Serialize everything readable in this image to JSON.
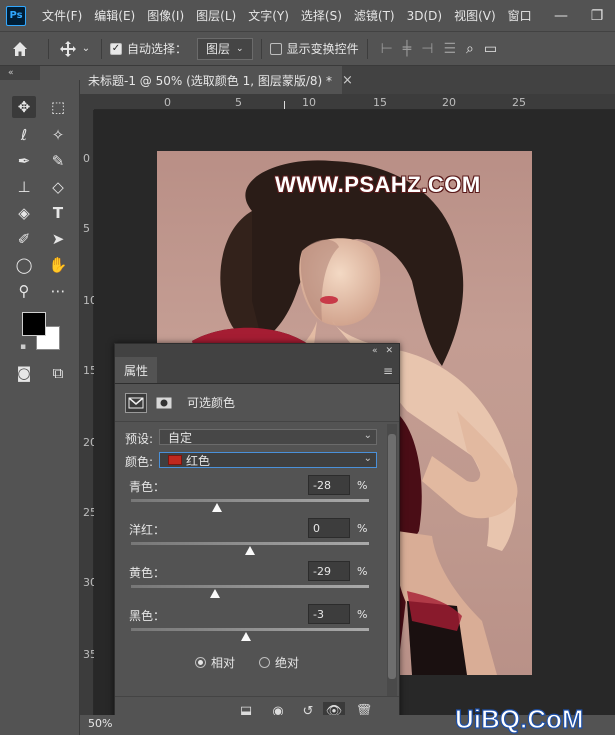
{
  "app": {
    "logo": "Ps"
  },
  "menu": [
    "文件(F)",
    "编辑(E)",
    "图像(I)",
    "图层(L)",
    "文字(Y)",
    "选择(S)",
    "滤镜(T)",
    "3D(D)",
    "视图(V)",
    "窗口"
  ],
  "window_buttons": {
    "minimize": "—",
    "restore": "❐"
  },
  "options_bar": {
    "auto_select_label": "自动选择：",
    "auto_select_target": "图层",
    "show_transform_label": "显示变换控件"
  },
  "document_tab": {
    "title": "未标题-1 @ 50% (选取颜色 1, 图层蒙版/8) *",
    "close": "×"
  },
  "ruler": {
    "top_labels": [
      "0",
      "5",
      "10",
      "15",
      "20",
      "25"
    ],
    "left_labels": [
      "0",
      "5",
      "10",
      "15",
      "20",
      "25",
      "30",
      "35"
    ]
  },
  "canvas": {
    "watermark": "WWW.PSAHZ.COM"
  },
  "status": {
    "zoom": "50%"
  },
  "site_watermark": "UiBQ.CoM",
  "properties_panel": {
    "tab": "属性",
    "adjustment_title": "可选颜色",
    "preset_label": "预设:",
    "preset_value": "自定",
    "colors_label": "颜色:",
    "colors_value": "红色",
    "colors_chip": "#c0281e",
    "sliders": [
      {
        "label": "青色：",
        "value": "-28",
        "unit": "%",
        "amount": -28
      },
      {
        "label": "洋红：",
        "value": "0",
        "unit": "%",
        "amount": 0
      },
      {
        "label": "黄色：",
        "value": "-29",
        "unit": "%",
        "amount": -29
      },
      {
        "label": "黑色：",
        "value": "-3",
        "unit": "%",
        "amount": -3
      }
    ],
    "method": {
      "relative": "相对",
      "absolute": "绝对",
      "selected": "relative"
    }
  }
}
